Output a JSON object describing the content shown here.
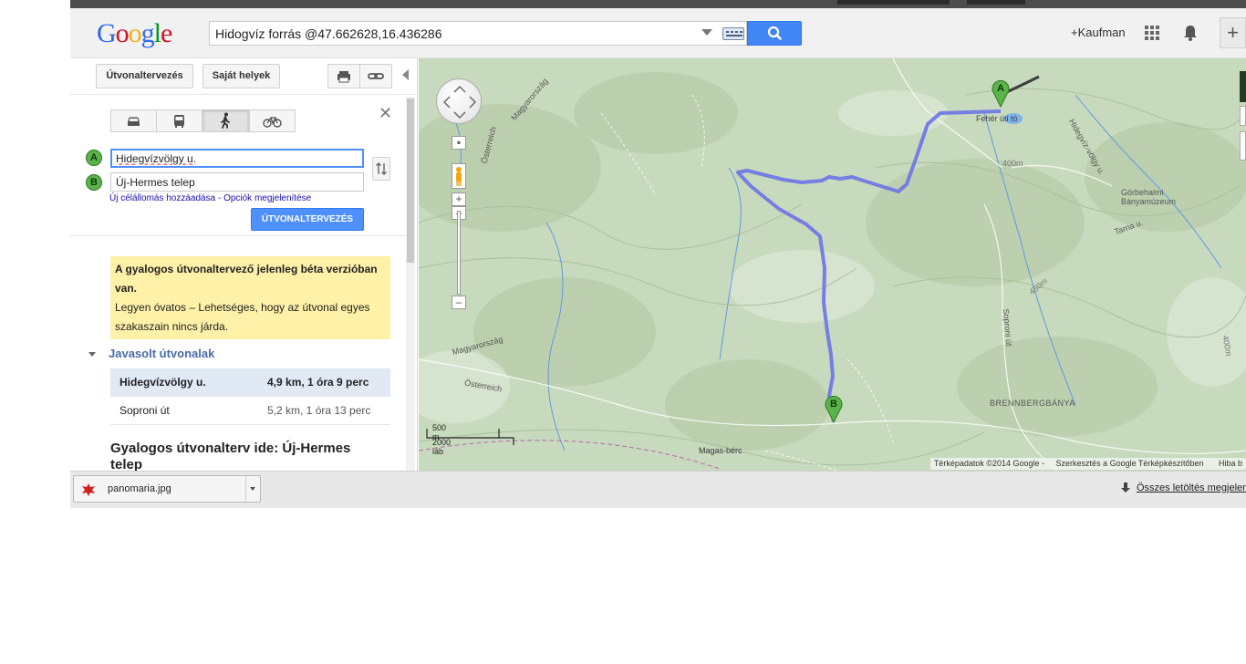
{
  "header": {
    "logo": "Google",
    "search_value": "Hidogvíz forrás @47.662628,16.436286",
    "user": "+Kaufman"
  },
  "toolbar": {
    "route_planning": "Útvonaltervezés",
    "my_places": "Saját helyek"
  },
  "directions": {
    "waypoint_a_marker": "A",
    "waypoint_b_marker": "B",
    "waypoint_a": "Hidegvízvölgy u.",
    "waypoint_b": "Új-Hermes telep",
    "add_destination": "Új célállomás hozzáadása",
    "separator": " - ",
    "show_options": "Opciók megjelenítése",
    "route_button": "ÚTVONALTERVEZÉS",
    "warning_title": "A gyalogos útvonaltervező jelenleg béta verzióban van.",
    "warning_body": "Legyen óvatos – Lehetséges, hogy az útvonal egyes szakaszain nincs járda.",
    "suggested_heading": "Javasolt útvonalak",
    "routes": [
      {
        "name": "Hidegvízvölgy u.",
        "distance": "4,9 km, 1 óra 9 perc"
      },
      {
        "name": "Soproni út",
        "distance": "5,2 km, 1 óra 13 perc"
      }
    ],
    "walking_title": "Gyalogos útvonalterv ide: Új-Hermes telep"
  },
  "map": {
    "labels": {
      "feher_uti_to": "Fehér úti tó",
      "gorbehalmi": "Görbehalmi",
      "banyamuzeum": "Bányamúzeum",
      "tarna_u": "Tarna u.",
      "hidegvizvolgy_u": "Hidegvíz-völgy u.",
      "soproni_ut": "Soproni út",
      "brennbergbanya": "BRENNBERGBÁNYA",
      "osterreich_1": "Österreich",
      "magyarorszag_1": "Magyarország",
      "magyarorszag_2": "Magyarország",
      "osterreich_2": "Österreich",
      "magas_berc": "Magas-bérc",
      "contour_400": "400m",
      "contour_450": "450m",
      "contour_400b": "400m"
    },
    "pin_a": "A",
    "pin_b": "B",
    "scale_metric": "500 m",
    "scale_imperial": "2000 láb",
    "attribution": "Térképadatok ©2014 Google -",
    "report": "Szerkesztés a Google Térképkészítőben",
    "error": "Hiba b"
  },
  "downloads": {
    "file": "panomaria.jpg",
    "show_all": "Összes letöltés megjelenítése"
  },
  "colors": {
    "route": "#6b73e6",
    "map_bg": "#c9dbbf",
    "search_button": "#4285f4",
    "warning_bg": "#fff1a8",
    "marker_green": "#5bb34a"
  }
}
